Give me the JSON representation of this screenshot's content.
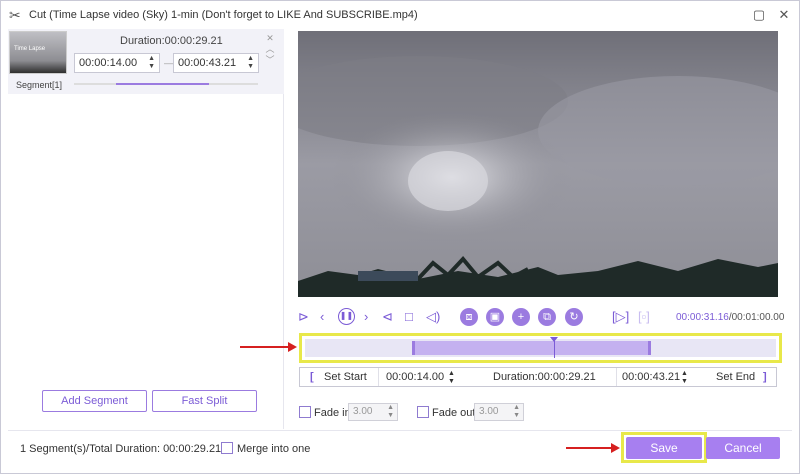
{
  "window": {
    "title": "Cut (Time Lapse video (Sky) 1-min (Don't forget to LIKE And SUBSCRIBE.mp4)",
    "scissors_icon": "scissors-icon",
    "maximize_icon": "maximize-icon",
    "close_icon": "close-icon"
  },
  "segment": {
    "thumbnail_text": "Time Lapse",
    "duration_label": "Duration:00:00:29.21",
    "start_value": "00:00:14.00",
    "end_value": "00:00:43.21",
    "label": "Segment[1]",
    "progress": 0.5
  },
  "left_buttons": {
    "add_segment": "Add Segment",
    "fast_split": "Fast Split"
  },
  "playback": {
    "current_time": "00:00:31.16",
    "total_time": "/00:01:00.00"
  },
  "timeline": {
    "range_start": 0.233,
    "range_end": 0.72,
    "playhead": 0.519
  },
  "edit": {
    "set_start": "Set Start",
    "start_value": "00:00:14.00",
    "duration": "Duration:00:00:29.21",
    "end_value": "00:00:43.21",
    "set_end": "Set End"
  },
  "fade": {
    "fade_in_label": "Fade in",
    "fade_in_value": "3.00",
    "fade_out_label": "Fade out",
    "fade_out_value": "3.00"
  },
  "footer": {
    "summary": "1 Segment(s)/Total Duration: 00:00:29.21",
    "merge_label": "Merge into one",
    "save": "Save",
    "cancel": "Cancel"
  },
  "colors": {
    "accent": "#9b7be0",
    "highlight": "#e8e84a",
    "annotation_arrow": "#d62020"
  }
}
